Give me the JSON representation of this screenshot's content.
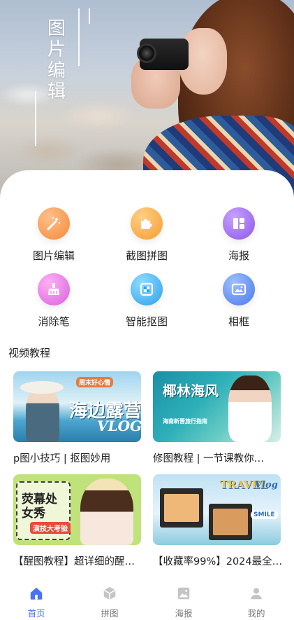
{
  "hero": {
    "title_chars": [
      "图",
      "片",
      "编",
      "辑"
    ]
  },
  "tools": [
    {
      "label": "图片编辑",
      "icon": "magic-wand-icon",
      "color": "#f7a04d"
    },
    {
      "label": "截图拼图",
      "icon": "puzzle-icon",
      "color": "#f9ad3f"
    },
    {
      "label": "海报",
      "icon": "poster-layout-icon",
      "color": "#a572f0"
    },
    {
      "label": "消除笔",
      "icon": "eraser-brush-icon",
      "color": "#e97bea"
    },
    {
      "label": "智能抠图",
      "icon": "cutout-icon",
      "color": "#4bb7f2"
    },
    {
      "label": "相框",
      "icon": "image-frame-icon",
      "color": "#5d8ef6"
    }
  ],
  "tutorials": {
    "title": "视频教程",
    "items": [
      {
        "caption": "p图小技巧 | 抠图妙用",
        "thumb_text": "海边露营",
        "thumb_sub": "VLOG",
        "thumb_tag": "周末好心情"
      },
      {
        "caption": "修图教程 | 一节课教你…",
        "thumb_text": "椰林海风",
        "thumb_sub": "海南新晋旅行指南"
      },
      {
        "caption": "【醒图教程】超详细的醒…",
        "thumb_text": "荧幕处女秀",
        "thumb_sub": "演技大考验"
      },
      {
        "caption": "【收藏率99%】2024最全…",
        "thumb_text": "TRAVEL",
        "thumb_sub": "Vlog",
        "thumb_tag": "SMILE"
      }
    ]
  },
  "nav": [
    {
      "label": "首页",
      "icon": "home-icon",
      "active": true
    },
    {
      "label": "拼图",
      "icon": "cube-collage-icon",
      "active": false
    },
    {
      "label": "海报",
      "icon": "picture-poster-icon",
      "active": false
    },
    {
      "label": "我的",
      "icon": "user-profile-icon",
      "active": false
    }
  ],
  "colors": {
    "accent": "#4a72f5",
    "inactive": "#c5c5c5"
  }
}
